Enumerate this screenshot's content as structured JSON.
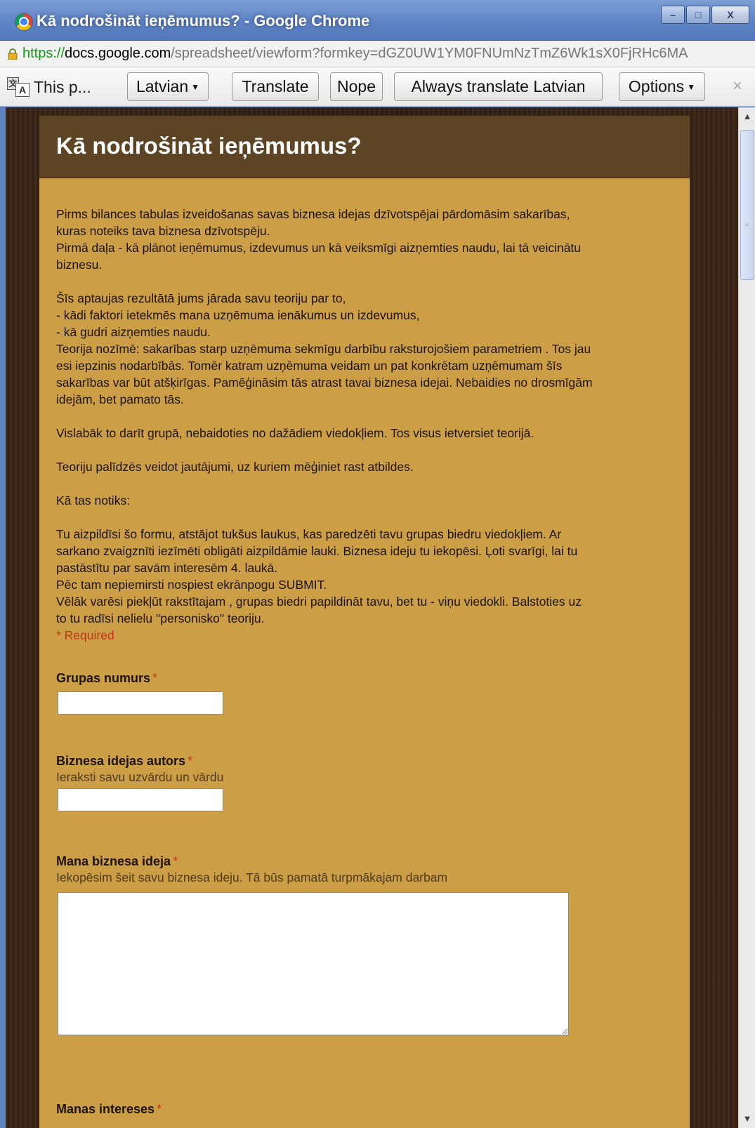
{
  "window": {
    "title": "Kā nodrošināt ieņēmumus? - Google Chrome",
    "minimize_glyph": "–",
    "maximize_glyph": "□",
    "close_glyph": "X"
  },
  "address": {
    "scheme": "https://",
    "host": "docs.google.com",
    "path": "/spreadsheet/viewform?formkey=dGZ0UW1YM0FNUmNzTmZ6Wk1sX0FjRHc6MA"
  },
  "translate_bar": {
    "message": "This p...",
    "language_select": "Latvian",
    "translate_button": "Translate",
    "nope_button": "Nope",
    "always_button": "Always translate Latvian",
    "options_button": "Options",
    "close_glyph": "×"
  },
  "form": {
    "title": "Kā nodrošināt ieņēmumus?",
    "description": {
      "p1": [
        "Pirms  bilances tabulas izveidošanas savas biznesa idejas dzīvotspējai pārdomāsim sakarības,",
        "kuras noteiks tava biznesa dzīvotspēju.",
        "Pirmā daļa - kā plānot ieņēmumus, izdevumus un kā veiksmīgi aizņemties naudu, lai tā veicinātu",
        "biznesu."
      ],
      "p2": [
        "Šīs aptaujas rezultātā jums jārada savu teoriju par to,",
        " - kādi faktori ietekmēs mana uzņēmuma ienākumus un izdevumus,",
        " - kā gudri aizņemties naudu.",
        "Teorija nozīmē: sakarības starp uzņēmuma sekmīgu darbību raksturojošiem parametriem . Tos jau",
        "esi iepzinis nodarbībās. Tomēr katram uzņēmuma veidam un pat konkrētam uzņēmumam šīs",
        "sakarības var būt atšķirīgas. Pamēģināsim tās atrast tavai biznesa idejai. Nebaidies no drosmīgām",
        "idejām, bet pamato tās."
      ],
      "p3": "Vislabāk to darīt grupā, nebaidoties no dažādiem viedokļiem. Tos visus ietversiet teorijā.",
      "p4": "Teoriju palīdzēs veidot jautājumi, uz kuriem mēģiniet rast atbildes.",
      "p5": "Kā tas notiks:",
      "p6": [
        "Tu aizpildīsi šo formu, atstājot tukšus laukus, kas paredzēti tavu grupas biedru viedokļiem. Ar",
        "sarkano zvaigznīti iezīmēti obligāti aizpildāmie lauki. Biznesa ideju tu iekopēsi. Ļoti svarīgi, lai tu",
        "pastāstītu par savām interesēm 4. laukā.",
        "Pēc tam nepiemirsti nospiest ekrānpogu SUBMIT.",
        "Vēlāk varēsi piekļūt rakstītajam , grupas biedri papildināt tavu, bet tu - viņu viedokli. Balstoties uz",
        "to tu radīsi nelielu \"personisko\" teoriju."
      ]
    },
    "required_note": "* Required",
    "required_star": "*",
    "questions": {
      "q1": {
        "label": "Grupas numurs",
        "value": ""
      },
      "q2": {
        "label": "Biznesa idejas autors",
        "help": "Ieraksti savu uzvārdu un vārdu",
        "value": ""
      },
      "q3": {
        "label": "Mana biznesa ideja",
        "help": "Iekopēsim šeit savu biznesa ideju. Tā būs pamatā turpmākajam darbam",
        "value": ""
      },
      "q4": {
        "label": "Manas intereses"
      }
    }
  },
  "colors": {
    "form_background": "#cc9e46",
    "header_background": "#5c4424",
    "required_red": "#c4361c",
    "page_background": "#2f1e12"
  }
}
